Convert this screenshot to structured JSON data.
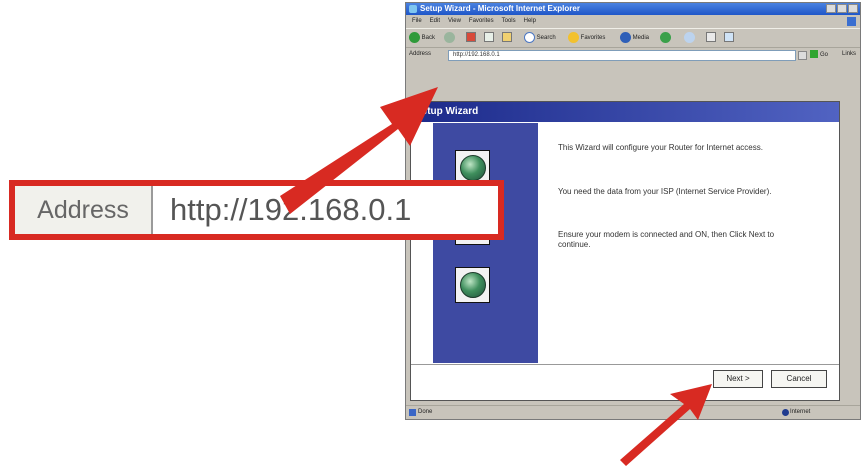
{
  "browser": {
    "title": "Setup Wizard - Microsoft Internet Explorer",
    "menu": [
      "File",
      "Edit",
      "View",
      "Favorites",
      "Tools",
      "Help"
    ],
    "toolbar": {
      "back": "Back",
      "search": "Search",
      "favorites": "Favorites",
      "media": "Media"
    },
    "address_label": "Address",
    "address_value": "http://192.168.0.1",
    "go": "Go",
    "links": "Links",
    "status": "Done",
    "zone": "Internet"
  },
  "wizard": {
    "title": "Setup Wizard",
    "paragraphs": [
      "This Wizard will configure your Router for Internet access.",
      "You need the data from your ISP (Internet Service Provider).",
      "Ensure your modem is connected and ON, then Click Next to continue."
    ],
    "next_label": "Next >",
    "cancel_label": "Cancel"
  },
  "callout": {
    "label": "Address",
    "url": "http://192.168.0.1"
  },
  "colors": {
    "arrow": "#d82a22",
    "wizard_sidebar": "#3e4aa2",
    "titlebar": "#1f56c8"
  }
}
